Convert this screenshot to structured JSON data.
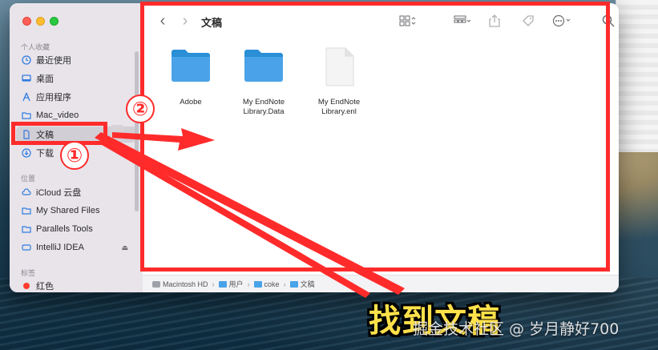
{
  "sidebar": {
    "favorites_title": "个人收藏",
    "favorites": [
      {
        "label": "最近使用",
        "icon": "clock-icon"
      },
      {
        "label": "桌面",
        "icon": "desktop-icon"
      },
      {
        "label": "应用程序",
        "icon": "applications-icon"
      },
      {
        "label": "Mac_video",
        "icon": "folder-icon"
      },
      {
        "label": "文稿",
        "icon": "document-icon"
      },
      {
        "label": "下载",
        "icon": "download-icon"
      }
    ],
    "locations_title": "位置",
    "locations": [
      {
        "label": "iCloud 云盘",
        "icon": "cloud-icon"
      },
      {
        "label": "My Shared Files",
        "icon": "folder-icon"
      },
      {
        "label": "Parallels Tools",
        "icon": "folder-icon"
      },
      {
        "label": "IntelliJ IDEA",
        "icon": "disk-icon",
        "eject": "⏏"
      }
    ],
    "tags_title": "标签",
    "tags": [
      {
        "label": "红色",
        "color": "#ff3b30"
      }
    ]
  },
  "toolbar": {
    "title": "文稿",
    "back": "‹",
    "forward": "›"
  },
  "files": [
    {
      "label": "Adobe",
      "type": "folder"
    },
    {
      "label": "My EndNote Library.Data",
      "type": "folder"
    },
    {
      "label": "My EndNote Library.enl",
      "type": "document"
    }
  ],
  "pathbar": [
    "Macintosh HD",
    "用户",
    "coke",
    "文稿"
  ],
  "annotations": {
    "badge1": "①",
    "badge2": "②",
    "caption": "找到文稿",
    "watermark": "掘金技术社区 @ 岁月静好700"
  },
  "colors": {
    "annotation": "#ff2b2b",
    "folder": "#4aa3e8",
    "caption": "#ffe14a"
  }
}
